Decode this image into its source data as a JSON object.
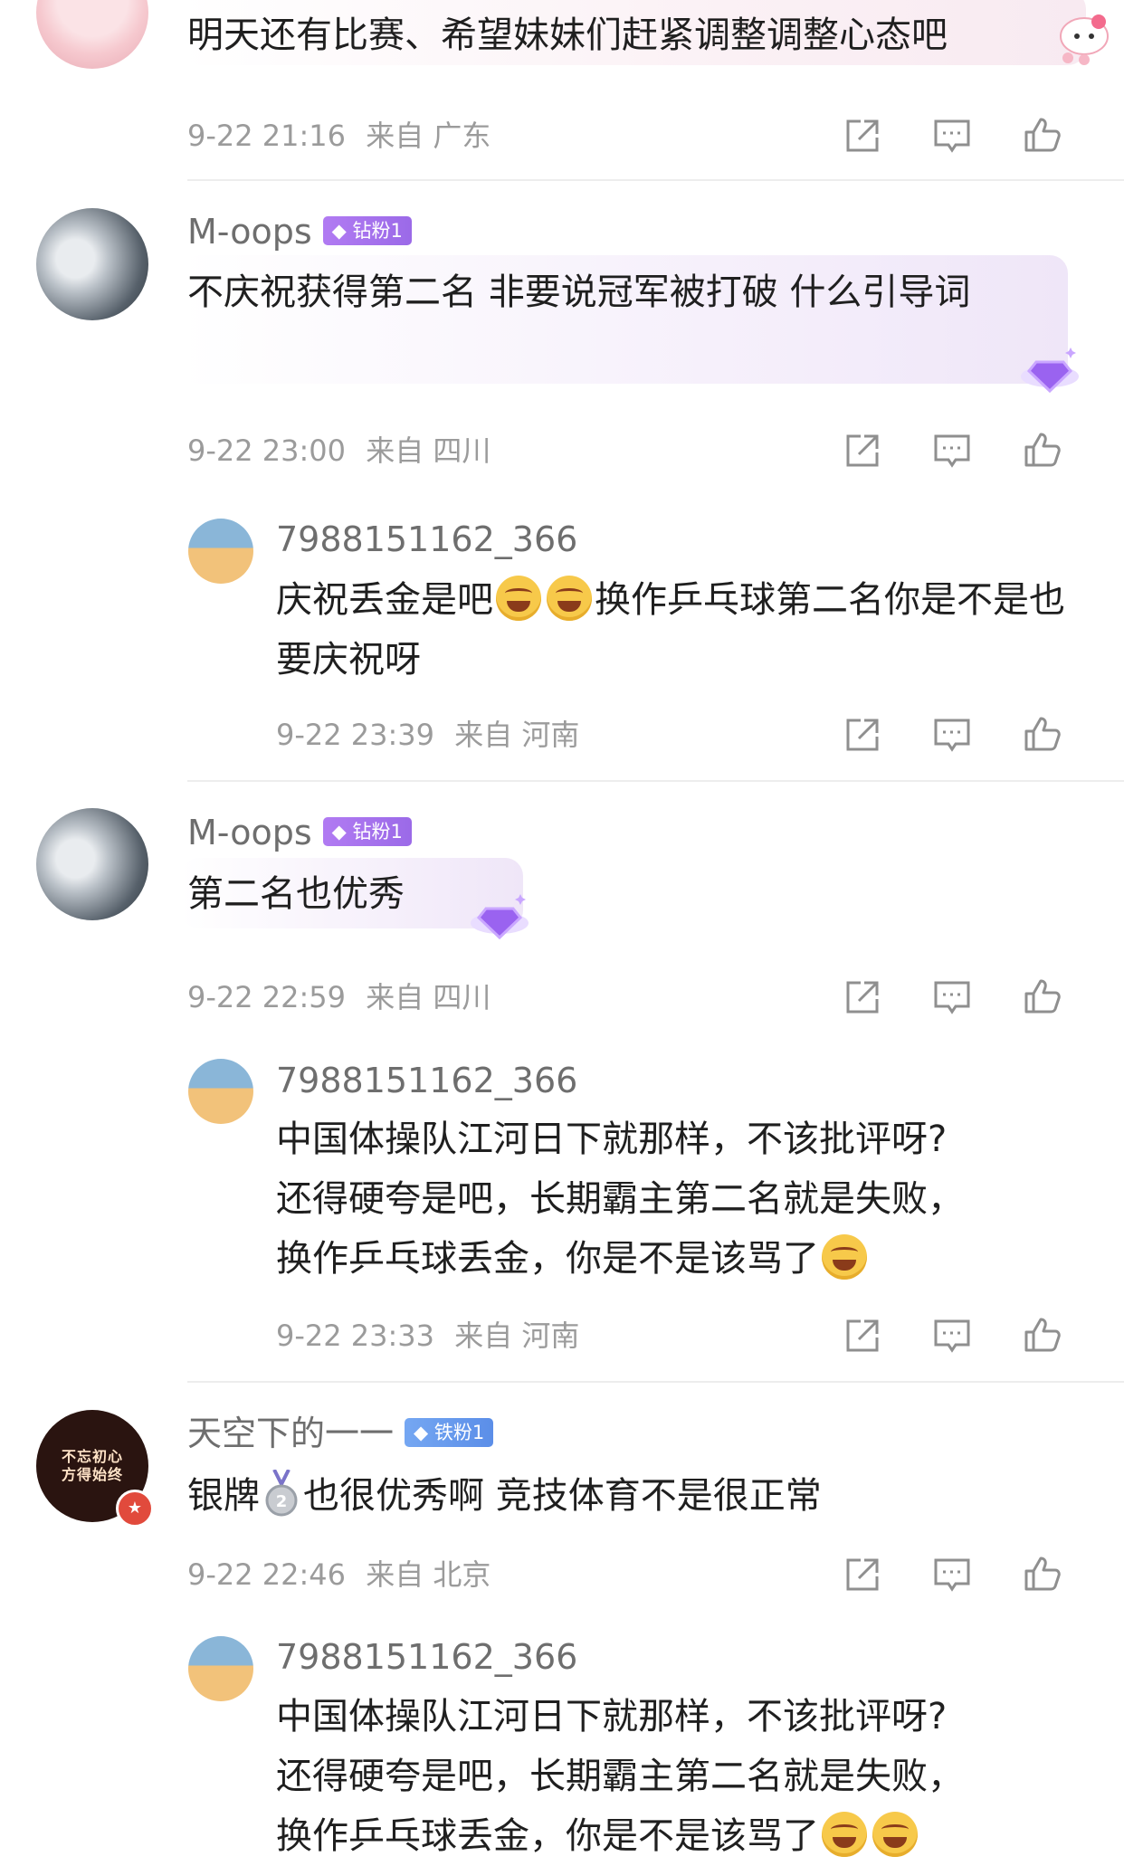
{
  "comments": [
    {
      "username": "",
      "text": "明天还有比赛、希望妹妹们赶紧调整调整心态吧",
      "time": "9-22 21:16",
      "location": "来自 广东"
    },
    {
      "username": "M-oops",
      "fan_badge": "钻粉1",
      "text": "不庆祝获得第二名 非要说冠军被打破 什么引导词",
      "time": "9-22 23:00",
      "location": "来自 四川",
      "reply": {
        "username": "7988151162_366",
        "text_parts": [
          "庆祝丢金是吧",
          "换作乒乓球第二名你是不是也要庆祝呀"
        ],
        "time": "9-22 23:39",
        "location": "来自 河南"
      }
    },
    {
      "username": "M-oops",
      "fan_badge": "钻粉1",
      "text": "第二名也优秀",
      "time": "9-22 22:59",
      "location": "来自 四川",
      "reply": {
        "username": "7988151162_366",
        "text_lines": [
          "中国体操队江河日下就那样，不该批评呀?",
          "还得硬夸是吧，长期霸主第二名就是失败，",
          "换作乒乓球丢金，你是不是该骂了"
        ],
        "time": "9-22 23:33",
        "location": "来自 河南"
      }
    },
    {
      "username": "天空下的一一",
      "fan_badge": "铁粉1",
      "avatar_text": [
        "不忘初心",
        "方得始终"
      ],
      "text_parts": [
        "银牌",
        "也很优秀啊 竞技体育不是很正常"
      ],
      "time": "9-22 22:46",
      "location": "来自 北京",
      "reply": {
        "username": "7988151162_366",
        "text_lines": [
          "中国体操队江河日下就那样，不该批评呀?",
          "还得硬夸是吧，长期霸主第二名就是失败，",
          "换作乒乓球丢金，你是不是该骂了"
        ]
      }
    }
  ],
  "icons": {
    "share": "share-icon",
    "comment": "comment-icon",
    "like": "thumbs-up-icon"
  },
  "colors": {
    "meta": "#9b9b9b",
    "username": "#6e6e6e",
    "fan_purple": "#a673f0",
    "fan_blue": "#5b8ee8"
  }
}
